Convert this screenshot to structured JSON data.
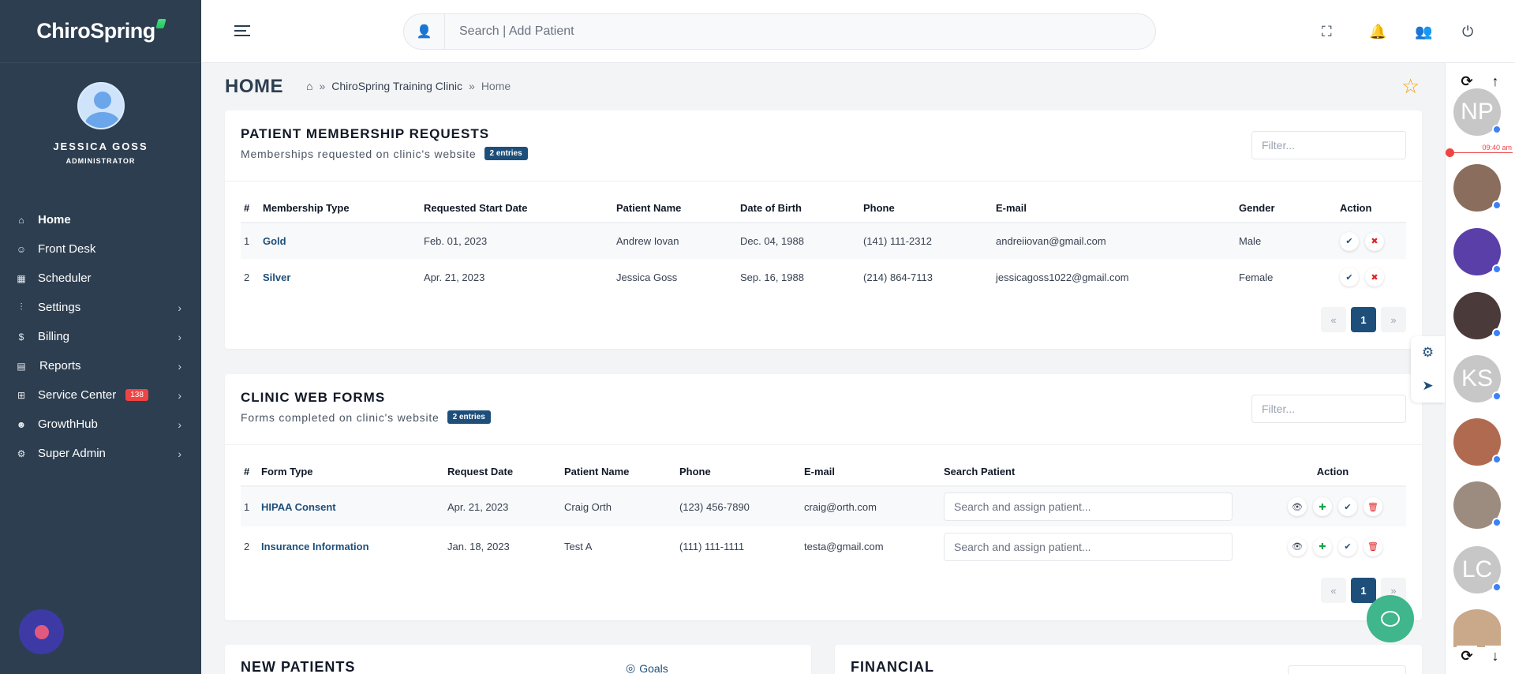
{
  "brand": "ChiroSpring",
  "user": {
    "name": "JESSICA GOSS",
    "role": "ADMINISTRATOR"
  },
  "nav": [
    {
      "label": "Home",
      "icon": "home-icon",
      "chevron": false
    },
    {
      "label": "Front Desk",
      "icon": "user-desk-icon",
      "chevron": false
    },
    {
      "label": "Scheduler",
      "icon": "calendar-icon",
      "chevron": false
    },
    {
      "label": "Settings",
      "icon": "sliders-icon",
      "chevron": true
    },
    {
      "label": "Billing",
      "icon": "dollar-icon",
      "chevron": true
    },
    {
      "label": "Reports",
      "icon": "report-icon",
      "chevron": true
    },
    {
      "label": "Service Center",
      "icon": "grid-icon",
      "chevron": true,
      "badge": "138"
    },
    {
      "label": "GrowthHub",
      "icon": "growth-icon",
      "chevron": true
    },
    {
      "label": "Super Admin",
      "icon": "gear-icon",
      "chevron": true
    }
  ],
  "search": {
    "placeholder": "Search | Add Patient"
  },
  "page": {
    "title": "HOME",
    "breadcrumb": [
      "ChiroSpring Training Clinic",
      "Home"
    ]
  },
  "rail": {
    "time": "09:40 am",
    "avatars": [
      {
        "initials": "NP",
        "color": "#c7c7c7"
      },
      {
        "initials": "",
        "color": "#8a6d5c"
      },
      {
        "initials": "",
        "color": "#5b3fa8"
      },
      {
        "initials": "",
        "color": "#4a3a3a"
      },
      {
        "initials": "KS",
        "color": "#c7c7c7"
      },
      {
        "initials": "",
        "color": "#b06a4f"
      },
      {
        "initials": "",
        "color": "#9c8c80"
      },
      {
        "initials": "LC",
        "color": "#c7c7c7"
      }
    ]
  },
  "membership": {
    "title": "PATIENT MEMBERSHIP REQUESTS",
    "subtitle": "Memberships requested on clinic's website",
    "badge": "2 entries",
    "filter_placeholder": "Filter...",
    "columns": [
      "#",
      "Membership Type",
      "Requested Start Date",
      "Patient Name",
      "Date of Birth",
      "Phone",
      "E-mail",
      "Gender",
      "Action"
    ],
    "rows": [
      {
        "n": "1",
        "type": "Gold",
        "start": "Feb. 01, 2023",
        "name": "Andrew Iovan",
        "dob": "Dec. 04, 1988",
        "phone": "(141) 111-2312",
        "email": "andreiiovan@gmail.com",
        "gender": "Male"
      },
      {
        "n": "2",
        "type": "Silver",
        "start": "Apr. 21, 2023",
        "name": "Jessica Goss",
        "dob": "Sep. 16, 1988",
        "phone": "(214) 864-7113",
        "email": "jessicagoss1022@gmail.com",
        "gender": "Female"
      }
    ],
    "pager": {
      "prev": "«",
      "current": "1",
      "next": "»"
    }
  },
  "forms": {
    "title": "CLINIC WEB FORMS",
    "subtitle": "Forms completed on clinic's website",
    "badge": "2 entries",
    "filter_placeholder": "Filter...",
    "columns": [
      "#",
      "Form Type",
      "Request Date",
      "Patient Name",
      "Phone",
      "E-mail",
      "Search Patient",
      "Action"
    ],
    "assign_placeholder": "Search and assign patient...",
    "rows": [
      {
        "n": "1",
        "type": "HIPAA Consent",
        "date": "Apr. 21, 2023",
        "name": "Craig Orth",
        "phone": "(123) 456-7890",
        "email": "craig@orth.com"
      },
      {
        "n": "2",
        "type": "Insurance Information",
        "date": "Jan. 18, 2023",
        "name": "Test A",
        "phone": "(111) 111-1111",
        "email": "testa@gmail.com"
      }
    ],
    "pager": {
      "prev": "«",
      "current": "1",
      "next": "»"
    }
  },
  "bottom": {
    "new_patients": "NEW PATIENTS",
    "goals": "Goals",
    "financial": "FINANCIAL"
  }
}
